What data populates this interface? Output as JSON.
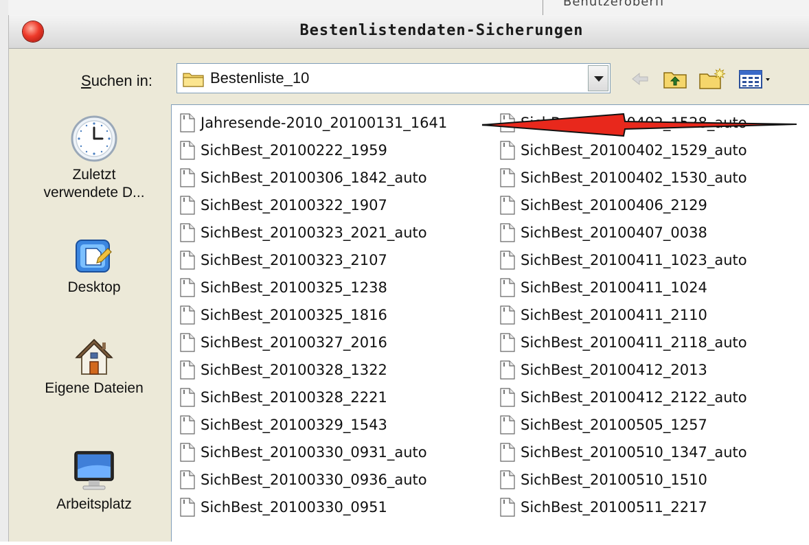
{
  "window": {
    "title": "Bestenlistendaten-Sicherungen"
  },
  "look_in": {
    "label_mnemonic": "S",
    "label_rest": "uchen in:",
    "value": "Bestenliste_10"
  },
  "toolbar": {
    "icons": [
      "back-arrow-icon",
      "up-folder-icon",
      "new-folder-icon",
      "view-menu-icon"
    ]
  },
  "sidebar": {
    "items": [
      {
        "label_line1": "Zuletzt",
        "label_line2": "verwendete D...",
        "icon": "clock-icon"
      },
      {
        "label_line1": "Desktop",
        "icon": "desktop-icon"
      },
      {
        "label_line1": "Eigene Dateien",
        "icon": "home-icon"
      },
      {
        "label_line1": "Arbeitsplatz",
        "icon": "computer-icon"
      }
    ]
  },
  "files": {
    "column1": [
      "Jahresende-2010_20100131_1641",
      "SichBest_20100222_1959",
      "SichBest_20100306_1842_auto",
      "SichBest_20100322_1907",
      "SichBest_20100323_2021_auto",
      "SichBest_20100323_2107",
      "SichBest_20100325_1238",
      "SichBest_20100325_1816",
      "SichBest_20100327_2016",
      "SichBest_20100328_1322",
      "SichBest_20100328_2221",
      "SichBest_20100329_1543",
      "SichBest_20100330_0931_auto",
      "SichBest_20100330_0936_auto",
      "SichBest_20100330_0951"
    ],
    "column2": [
      "SichBest_20100402_1528_auto",
      "SichBest_20100402_1529_auto",
      "SichBest_20100402_1530_auto",
      "SichBest_20100406_2129",
      "SichBest_20100407_0038",
      "SichBest_20100411_1023_auto",
      "SichBest_20100411_1024",
      "SichBest_20100411_2110",
      "SichBest_20100411_2118_auto",
      "SichBest_20100412_2013",
      "SichBest_20100412_2122_auto",
      "SichBest_20100505_1257",
      "SichBest_20100510_1347_auto",
      "SichBest_20100510_1510",
      "SichBest_20100511_2217"
    ]
  },
  "background": {
    "behind_window_text": "Benutzeroberfl"
  },
  "colors": {
    "annotation_arrow": "#e8281c",
    "close_button": "#e53b2b"
  }
}
